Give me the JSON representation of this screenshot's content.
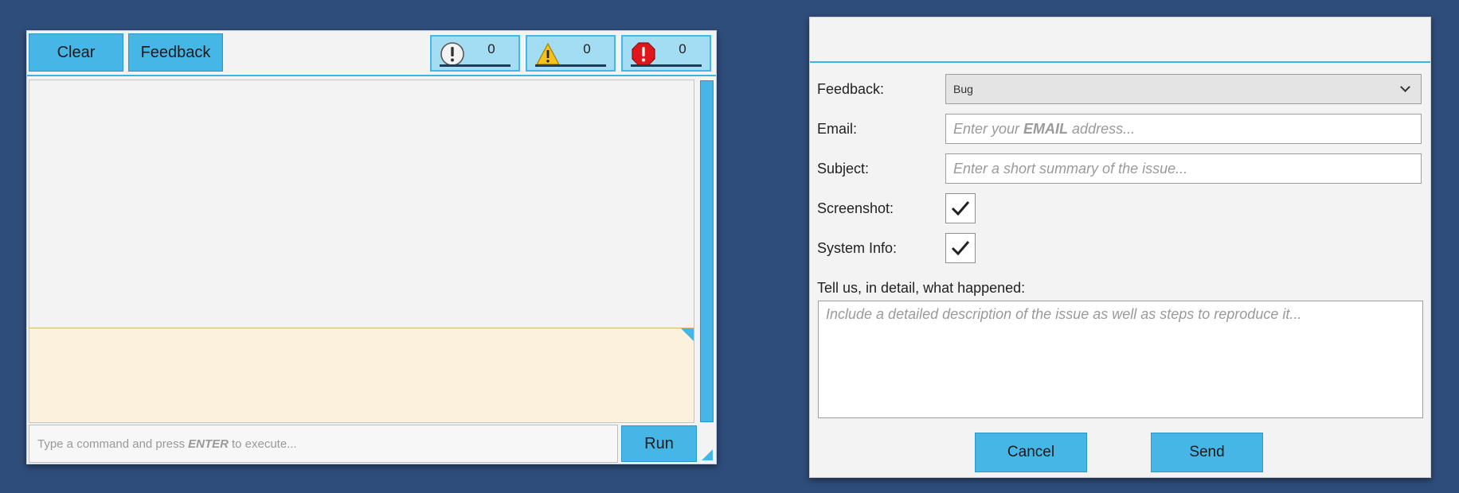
{
  "console": {
    "clear_label": "Clear",
    "feedback_label": "Feedback",
    "counters": {
      "info": "0",
      "warning": "0",
      "error": "0"
    },
    "command_placeholder_prefix": "Type a command and press",
    "command_placeholder_key": "ENTER",
    "command_placeholder_suffix": "to execute...",
    "run_label": "Run"
  },
  "feedback_form": {
    "feedback_label": "Feedback:",
    "feedback_type_value": "Bug",
    "email_label": "Email:",
    "email_placeholder_prefix": "Enter your",
    "email_placeholder_key": "EMAIL",
    "email_placeholder_suffix": "address...",
    "subject_label": "Subject:",
    "subject_placeholder": "Enter a short summary of the issue...",
    "screenshot_label": "Screenshot:",
    "screenshot_checked": true,
    "system_info_label": "System Info:",
    "system_info_checked": true,
    "detail_label": "Tell us, in detail, what happened:",
    "detail_placeholder": "Include a detailed description of the issue as well as steps to reproduce it...",
    "cancel_label": "Cancel",
    "send_label": "Send"
  },
  "icons": {
    "info": "info-icon",
    "warning": "warning-icon",
    "error": "error-icon",
    "checkmark": "checkmark-icon",
    "dropdown": "chevron-down-icon"
  },
  "colors": {
    "background": "#2f4d7b",
    "accent": "#45b6e6",
    "counter_bg": "#a3ddf4",
    "detail_bg": "#fbf1dc"
  }
}
